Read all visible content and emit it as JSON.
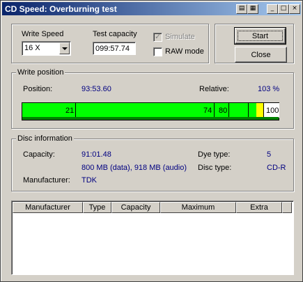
{
  "window": {
    "title": "CD Speed: Overburning test",
    "title_buttons": [
      "help-icon",
      "save-icon",
      "minimize-icon",
      "maximize-icon",
      "close-icon"
    ]
  },
  "settings": {
    "write_speed_label": "Write Speed",
    "write_speed_value": "16 X",
    "test_capacity_label": "Test capacity",
    "test_capacity_value": "099:57.74",
    "simulate_label": "Simulate",
    "simulate_checked": true,
    "simulate_enabled": false,
    "raw_mode_label": "RAW mode",
    "raw_mode_checked": false
  },
  "buttons": {
    "start": "Start",
    "close": "Close"
  },
  "write_position": {
    "title": "Write position",
    "position_label": "Position:",
    "position_value": "93:53.60",
    "relative_label": "Relative:",
    "relative_value": "103 %",
    "bar_ticks": [
      "21",
      "74",
      "80",
      "100"
    ],
    "progress_fraction": 0.939,
    "colors": {
      "fill": "#00ff00",
      "marker": "#ffff00",
      "base": "#008000"
    }
  },
  "disc_info": {
    "title": "Disc information",
    "capacity_label": "Capacity:",
    "capacity_value": "91:01.48",
    "size_value": "800 MB (data), 918 MB (audio)",
    "manufacturer_label": "Manufacturer:",
    "manufacturer_value": "TDK",
    "dye_type_label": "Dye type:",
    "dye_type_value": "5",
    "disc_type_label": "Disc type:",
    "disc_type_value": "CD-R"
  },
  "table": {
    "columns": [
      "Manufacturer",
      "Type",
      "Capacity",
      "Maximum",
      "Extra"
    ],
    "rows": []
  }
}
